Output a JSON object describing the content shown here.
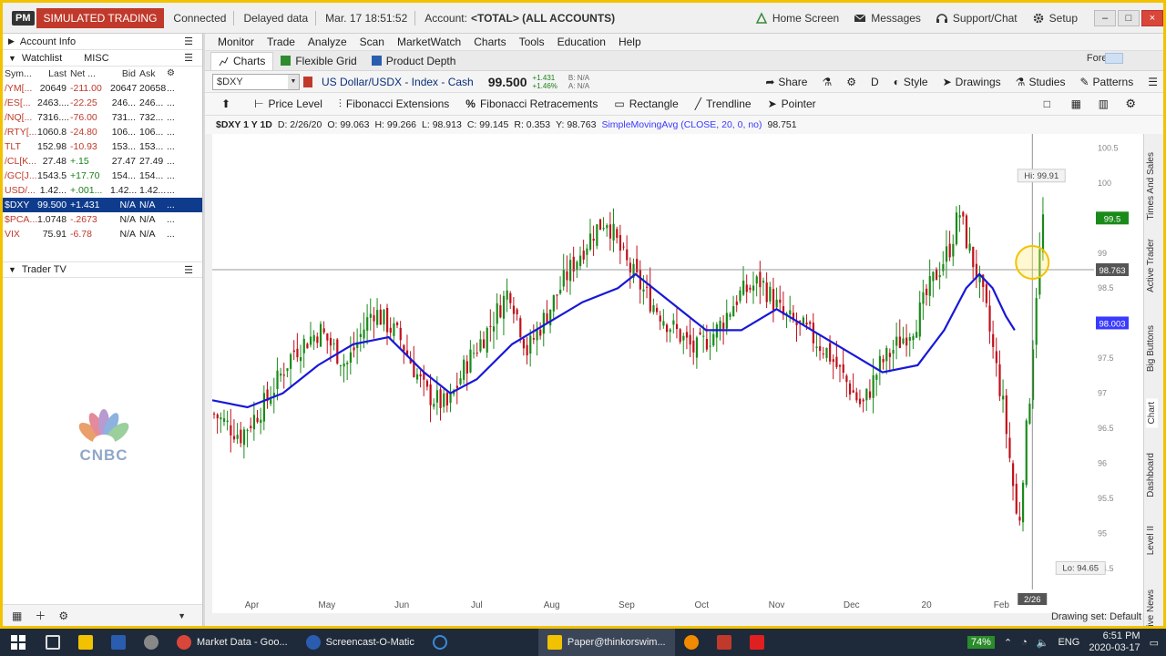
{
  "titlebar": {
    "logo": "PM",
    "mode": "SIMULATED TRADING",
    "connection": "Connected",
    "data_status": "Delayed data",
    "datetime": "Mar. 17  18:51:52",
    "account_label": "Account:",
    "account_value": "<TOTAL> (ALL ACCOUNTS)",
    "buttons": [
      "Home Screen",
      "Messages",
      "Support/Chat",
      "Setup"
    ]
  },
  "left_panel": {
    "account_info": "Account Info",
    "watchlist": "Watchlist",
    "watchlist_name": "MISC",
    "columns": [
      "Sym...",
      "Last",
      "Net ...",
      "Bid",
      "Ask"
    ],
    "rows": [
      {
        "sym": "/YM[...",
        "last": "20649",
        "net": "-211.00",
        "bid": "20647",
        "ask": "20658",
        "more": "..."
      },
      {
        "sym": "/ES[...",
        "last": "2463....",
        "net": "-22.25",
        "bid": "246...",
        "ask": "246...",
        "more": "..."
      },
      {
        "sym": "/NQ[...",
        "last": "7316....",
        "net": "-76.00",
        "bid": "731...",
        "ask": "732...",
        "more": "..."
      },
      {
        "sym": "/RTY[...",
        "last": "1060.8",
        "net": "-24.80",
        "bid": "106...",
        "ask": "106...",
        "more": "..."
      },
      {
        "sym": "TLT",
        "last": "152.98",
        "net": "-10.93",
        "bid": "153...",
        "ask": "153...",
        "more": "..."
      },
      {
        "sym": "/CL[K...",
        "last": "27.48",
        "net": "+.15",
        "bid": "27.47",
        "ask": "27.49",
        "more": "..."
      },
      {
        "sym": "/GC[J...",
        "last": "1543.5",
        "net": "+17.70",
        "bid": "154...",
        "ask": "154...",
        "more": "..."
      },
      {
        "sym": "USD/...",
        "last": "1.42...",
        "net": "+.001...",
        "bid": "1.42...",
        "ask": "1.42...",
        "more": "..."
      },
      {
        "sym": "$DXY",
        "last": "99.500",
        "net": "+1.431",
        "bid": "N/A",
        "ask": "N/A",
        "more": "..."
      },
      {
        "sym": "$PCA...",
        "last": "1.0748",
        "net": "-.2673",
        "bid": "N/A",
        "ask": "N/A",
        "more": "..."
      },
      {
        "sym": "VIX",
        "last": "75.91",
        "net": "-6.78",
        "bid": "N/A",
        "ask": "N/A",
        "more": "..."
      }
    ],
    "selected_row": 8,
    "trader_tv": "Trader TV",
    "cnbc_logo": "CNBC"
  },
  "menu": [
    "Monitor",
    "Trade",
    "Analyze",
    "Scan",
    "MarketWatch",
    "Charts",
    "Tools",
    "Education",
    "Help"
  ],
  "tabs": [
    "Charts",
    "Flexible Grid",
    "Product Depth"
  ],
  "forex_label": "Forex",
  "symbol_bar": {
    "symbol": "$DXY",
    "description": "US Dollar/USDX - Index - Cash",
    "price": "99.500",
    "change_abs": "+1.431",
    "change_pct": "+1.46%",
    "bid": "B: N/A",
    "ask": "A: N/A",
    "buttons": [
      "Share",
      "Style",
      "Drawings",
      "Studies",
      "Patterns"
    ],
    "d_label": "D"
  },
  "drawing_tools": [
    "Price Level",
    "Fibonacci Extensions",
    "Fibonacci Retracements",
    "Rectangle",
    "Trendline",
    "Pointer"
  ],
  "info_line": {
    "symbol_period": "$DXY 1 Y 1D",
    "date": "D: 2/26/20",
    "open": "O: 99.063",
    "high": "H: 99.266",
    "low": "L: 98.913",
    "close": "C: 99.145",
    "range": "R: 0.353",
    "y": "Y: 98.763",
    "study": "SimpleMovingAvg (CLOSE, 20, 0, no)",
    "study_value": "98.751"
  },
  "chart_data": {
    "type": "candlestick",
    "symbol": "$DXY",
    "x_tick_labels": [
      "Apr",
      "May",
      "Jun",
      "Jul",
      "Aug",
      "Sep",
      "Oct",
      "Nov",
      "Dec",
      "20",
      "Feb"
    ],
    "y_tick_labels": [
      "100.5",
      "100",
      "99.5",
      "99",
      "98.5",
      "98",
      "97.5",
      "97",
      "96.5",
      "96",
      "95.5",
      "95",
      "94.5"
    ],
    "ylim": [
      94.2,
      100.7
    ],
    "hi_label": "Hi: 99.91",
    "lo_label": "Lo: 94.65",
    "last_price_badge": "99.5",
    "crosshair_badge": "98.763",
    "sma_badge": "98.003",
    "crosshair_date": "2/26",
    "close_path": [
      [
        0,
        96.7
      ],
      [
        0.03,
        96.4
      ],
      [
        0.06,
        96.9
      ],
      [
        0.09,
        97.6
      ],
      [
        0.12,
        97.9
      ],
      [
        0.15,
        97.4
      ],
      [
        0.18,
        98.2
      ],
      [
        0.21,
        97.8
      ],
      [
        0.24,
        97.0
      ],
      [
        0.265,
        96.8
      ],
      [
        0.285,
        97.4
      ],
      [
        0.31,
        97.9
      ],
      [
        0.335,
        98.5
      ],
      [
        0.355,
        97.6
      ],
      [
        0.38,
        98.2
      ],
      [
        0.405,
        98.8
      ],
      [
        0.43,
        99.3
      ],
      [
        0.445,
        99.5
      ],
      [
        0.465,
        98.9
      ],
      [
        0.49,
        98.4
      ],
      [
        0.515,
        98.0
      ],
      [
        0.545,
        97.6
      ],
      [
        0.57,
        97.9
      ],
      [
        0.595,
        98.4
      ],
      [
        0.62,
        98.6
      ],
      [
        0.645,
        98.1
      ],
      [
        0.67,
        97.9
      ],
      [
        0.695,
        97.6
      ],
      [
        0.715,
        97.2
      ],
      [
        0.735,
        96.8
      ],
      [
        0.755,
        97.4
      ],
      [
        0.775,
        97.7
      ],
      [
        0.795,
        98.0
      ],
      [
        0.815,
        98.6
      ],
      [
        0.835,
        99.1
      ],
      [
        0.845,
        99.6
      ],
      [
        0.855,
        99.1
      ],
      [
        0.865,
        98.7
      ],
      [
        0.875,
        98.2
      ],
      [
        0.885,
        97.5
      ],
      [
        0.895,
        96.8
      ],
      [
        0.905,
        95.8
      ],
      [
        0.912,
        95.0
      ],
      [
        0.918,
        96.0
      ],
      [
        0.925,
        97.0
      ],
      [
        0.932,
        98.4
      ],
      [
        0.94,
        99.5
      ]
    ],
    "sma_path": [
      [
        0,
        96.9
      ],
      [
        0.04,
        96.8
      ],
      [
        0.08,
        97.0
      ],
      [
        0.12,
        97.4
      ],
      [
        0.16,
        97.7
      ],
      [
        0.2,
        97.8
      ],
      [
        0.24,
        97.3
      ],
      [
        0.27,
        97.0
      ],
      [
        0.3,
        97.2
      ],
      [
        0.34,
        97.7
      ],
      [
        0.38,
        98.0
      ],
      [
        0.42,
        98.3
      ],
      [
        0.46,
        98.5
      ],
      [
        0.48,
        98.7
      ],
      [
        0.52,
        98.3
      ],
      [
        0.56,
        97.9
      ],
      [
        0.6,
        97.9
      ],
      [
        0.64,
        98.2
      ],
      [
        0.68,
        97.9
      ],
      [
        0.72,
        97.6
      ],
      [
        0.76,
        97.3
      ],
      [
        0.8,
        97.4
      ],
      [
        0.83,
        97.9
      ],
      [
        0.855,
        98.5
      ],
      [
        0.87,
        98.7
      ],
      [
        0.885,
        98.5
      ],
      [
        0.9,
        98.1
      ],
      [
        0.91,
        97.9
      ]
    ],
    "sma_color": "#1818d8",
    "up_color": "#1a8a1a",
    "down_color": "#c0101a"
  },
  "right_tabs": [
    "Times And Sales",
    "Active Trader",
    "Big Buttons",
    "Chart",
    "Dashboard",
    "Level II",
    "Live News"
  ],
  "status": "Drawing set: Default",
  "taskbar": {
    "items": [
      "Market Data - Goo...",
      "Screencast-O-Matic",
      "Paper@thinkorswim..."
    ],
    "battery": "74%",
    "lang": "ENG",
    "time": "6:51 PM",
    "date": "2020-03-17"
  }
}
